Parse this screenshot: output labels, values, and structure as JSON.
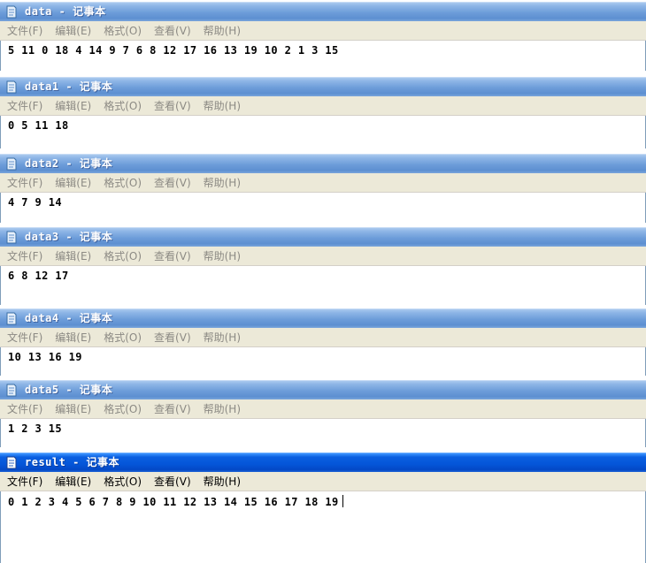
{
  "menu": {
    "file": "文件(F)",
    "edit": "编辑(E)",
    "format": "格式(O)",
    "view": "查看(V)",
    "help": "帮助(H)"
  },
  "windows": [
    {
      "title": "data - 记事本",
      "content": "5 11 0 18 4 14 9 7 6 8 12 17 16 13 19 10 2 1 3 15",
      "active": false
    },
    {
      "title": "data1 - 记事本",
      "content": "0 5 11 18",
      "active": false
    },
    {
      "title": "data2 - 记事本",
      "content": "4 7 9 14",
      "active": false
    },
    {
      "title": "data3 - 记事本",
      "content": "6 8 12 17",
      "active": false
    },
    {
      "title": "data4 - 记事本",
      "content": "10 13 16 19",
      "active": false
    },
    {
      "title": "data5 - 记事本",
      "content": "1 2 3 15",
      "active": false
    },
    {
      "title": "result - 记事本",
      "content": "0 1 2 3 4 5 6 7 8 9 10 11 12 13 14 15 16 17 18 19",
      "active": true
    }
  ]
}
